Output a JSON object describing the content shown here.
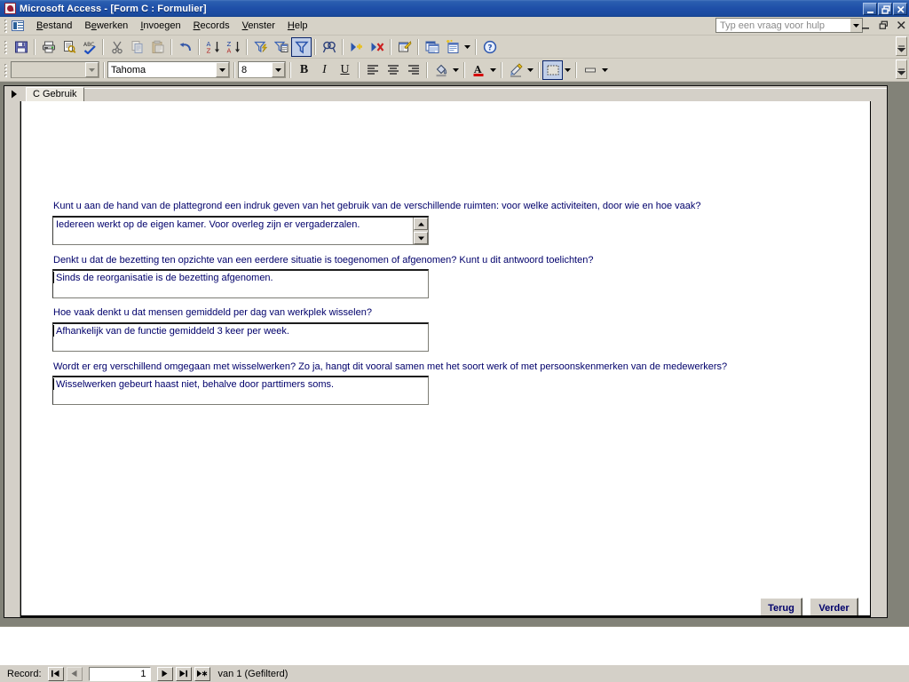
{
  "window": {
    "title": "Microsoft Access - [Form C : Formulier]",
    "app_icon": "access-key-icon",
    "minimize": "_",
    "restore": "❐",
    "close": "✕"
  },
  "menubar": {
    "items": [
      {
        "label": "Bestand",
        "accel": "B"
      },
      {
        "label": "Bewerken",
        "accel": "e"
      },
      {
        "label": "Invoegen",
        "accel": "I"
      },
      {
        "label": "Records",
        "accel": "R"
      },
      {
        "label": "Venster",
        "accel": "V"
      },
      {
        "label": "Help",
        "accel": "H"
      }
    ],
    "ask_a_question": {
      "placeholder": "Typ een vraag voor hulp",
      "value": ""
    },
    "mdi_minimize": "_",
    "mdi_restore": "❐",
    "mdi_close": "✕"
  },
  "toolbar_standard": {
    "buttons": [
      {
        "name": "save-icon",
        "tooltip": "Opslaan"
      },
      {
        "name": "print-icon",
        "tooltip": "Afdrukken"
      },
      {
        "name": "print-preview-icon",
        "tooltip": "Afdrukvoorbeeld"
      },
      {
        "name": "spelling-icon",
        "tooltip": "Spelling"
      },
      {
        "name": "cut-icon",
        "tooltip": "Knippen"
      },
      {
        "name": "copy-icon",
        "tooltip": "Kopiëren"
      },
      {
        "name": "paste-icon",
        "tooltip": "Plakken"
      },
      {
        "name": "undo-icon",
        "tooltip": "Ongedaan maken"
      },
      {
        "name": "sort-ascending-icon",
        "tooltip": "Oplopend sorteren"
      },
      {
        "name": "sort-descending-icon",
        "tooltip": "Aflopend sorteren"
      },
      {
        "name": "filter-by-selection-icon",
        "tooltip": "Filteren op selectie"
      },
      {
        "name": "filter-by-form-icon",
        "tooltip": "Filteren op formulier"
      },
      {
        "name": "apply-filter-icon",
        "tooltip": "Filter toepassen",
        "pressed": true
      },
      {
        "name": "find-icon",
        "tooltip": "Zoeken"
      },
      {
        "name": "new-record-icon",
        "tooltip": "Nieuw record"
      },
      {
        "name": "delete-record-icon",
        "tooltip": "Record verwijderen"
      },
      {
        "name": "properties-icon",
        "tooltip": "Eigenschappen"
      },
      {
        "name": "database-window-icon",
        "tooltip": "Databasevenster"
      },
      {
        "name": "new-object-icon",
        "tooltip": "Nieuw object"
      },
      {
        "name": "help-icon",
        "tooltip": "Help"
      }
    ],
    "overflow": "»"
  },
  "toolbar_formatting": {
    "object_select": {
      "value": "",
      "name": "object-select"
    },
    "font_name": {
      "value": "Tahoma",
      "name": "font-name-combo"
    },
    "font_size": {
      "value": "8",
      "name": "font-size-combo"
    },
    "bold": "B",
    "italic": "I",
    "underline": "U",
    "align_left": "align-left-icon",
    "align_center": "align-center-icon",
    "align_right": "align-right-icon",
    "fill_color": "fill-color-icon",
    "font_color": "font-color-icon",
    "line_color": "line-border-color-icon",
    "line_width": "line-width-icon",
    "special_effect": "special-effect-icon",
    "overflow": "»"
  },
  "form": {
    "tab": {
      "label": "C Gebruik"
    },
    "questions": [
      {
        "label": "Kunt u aan de hand van de plattegrond een indruk geven van het gebruik van de verschillende ruimten: voor welke activiteiten, door wie en hoe vaak?",
        "answer": "Iedereen werkt op de eigen kamer. Voor overleg zijn er vergaderzalen.",
        "has_scrollbar": true
      },
      {
        "label": "Denkt u dat de bezetting ten opzichte van een eerdere situatie is toegenomen of afgenomen? Kunt u dit antwoord toelichten?",
        "answer": "Sinds de reorganisatie is de bezetting afgenomen.",
        "has_scrollbar": false
      },
      {
        "label": "Hoe vaak denkt u dat mensen gemiddeld per dag van werkplek wisselen?",
        "answer": "Afhankelijk van de functie gemiddeld 3 keer per week.",
        "has_scrollbar": false
      },
      {
        "label": "Wordt er erg verschillend omgegaan met wisselwerken? Zo ja, hangt dit vooral samen met het soort werk of met persoonskenmerken van de medewerkers?",
        "answer": "Wisselwerken gebeurt haast niet, behalve door parttimers soms.",
        "has_scrollbar": false
      }
    ],
    "back_button": "Terug",
    "next_button": "Verder"
  },
  "status": {
    "record_label": "Record:",
    "first_button": "⏮",
    "prev_button": "◀",
    "current_record": "1",
    "next_button": "▶",
    "last_button": "⏭",
    "new_button": "▶*",
    "of_text": "van  1 (Gefilterd)"
  },
  "colors": {
    "titlebar": "#15428b",
    "toolbar_bg": "#d6d2c7",
    "form_text": "#00006b",
    "mdi_bg": "#828278",
    "canvas": "#ffffff"
  }
}
